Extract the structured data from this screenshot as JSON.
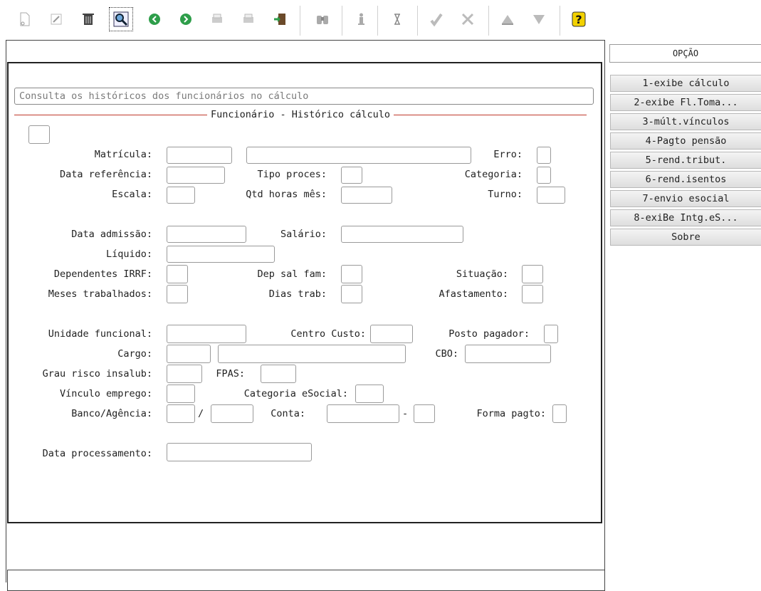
{
  "toolbar": {
    "buttons": [
      {
        "name": "new-icon",
        "glyph": "🗋"
      },
      {
        "name": "edit-icon",
        "glyph": "✎"
      },
      {
        "name": "delete-icon",
        "glyph": "🗑"
      },
      {
        "name": "search-icon",
        "glyph": "🔍"
      },
      {
        "name": "previous-icon",
        "glyph": "◀"
      },
      {
        "name": "next-icon",
        "glyph": "▶"
      },
      {
        "name": "print-icon",
        "glyph": "▤"
      },
      {
        "name": "print-preview-icon",
        "glyph": "▤"
      },
      {
        "name": "exit-icon",
        "glyph": "⇥"
      },
      {
        "name": "binoculars-icon",
        "glyph": "⚲"
      },
      {
        "name": "info-icon",
        "glyph": "ℹ"
      },
      {
        "name": "hourglass-icon",
        "glyph": "⧗"
      },
      {
        "name": "confirm-icon",
        "glyph": "✔"
      },
      {
        "name": "cancel-icon",
        "glyph": "✖"
      },
      {
        "name": "up-icon",
        "glyph": "▲"
      },
      {
        "name": "filter-icon",
        "glyph": "▼"
      },
      {
        "name": "help-icon",
        "glyph": "?"
      }
    ]
  },
  "description": "Consulta os históricos dos funcionários no cálculo",
  "group_title": "Funcionário - Histórico cálculo",
  "labels": {
    "matricula": "Matrícula:",
    "erro": "Erro:",
    "data_referencia": "Data referência:",
    "tipo_proces": "Tipo proces:",
    "categoria": "Categoria:",
    "escala": "Escala:",
    "qtd_horas_mes": "Qtd horas mês:",
    "turno": "Turno:",
    "data_admissao": "Data admissão:",
    "salario": "Salário:",
    "liquido": "Líquido:",
    "dependentes_irrf": "Dependentes IRRF:",
    "dep_sal_fam": "Dep sal fam:",
    "situacao": "Situação:",
    "meses_trabalhados": "Meses trabalhados:",
    "dias_trab": "Dias trab:",
    "afastamento": "Afastamento:",
    "unidade_funcional": "Unidade funcional:",
    "centro_custo": "Centro Custo:",
    "posto_pagador": "Posto pagador:",
    "cargo": "Cargo:",
    "cbo": "CBO:",
    "grau_risco": "Grau risco insalub:",
    "fpas": "FPAS:",
    "vinculo_emprego": "Vínculo emprego:",
    "categoria_esocial": "Categoria eSocial:",
    "banco_agencia": "Banco/Agência:",
    "slash": "/",
    "conta": "Conta:",
    "dash": "-",
    "forma_pagto": "Forma pagto:",
    "data_processamento": "Data processamento:"
  },
  "side_panel": {
    "header": "OPÇÃO",
    "options": [
      "1-exibe cálculo",
      "2-exibe Fl.Toma...",
      "3-múlt.vínculos",
      "4-Pagto pensão",
      "5-rend.tribut.",
      "6-rend.isentos",
      "7-envio esocial",
      "8-exiBe Intg.eS...",
      "Sobre"
    ]
  },
  "colors": {
    "group_line": "#c0392b",
    "help_icon": "#f2d100"
  }
}
